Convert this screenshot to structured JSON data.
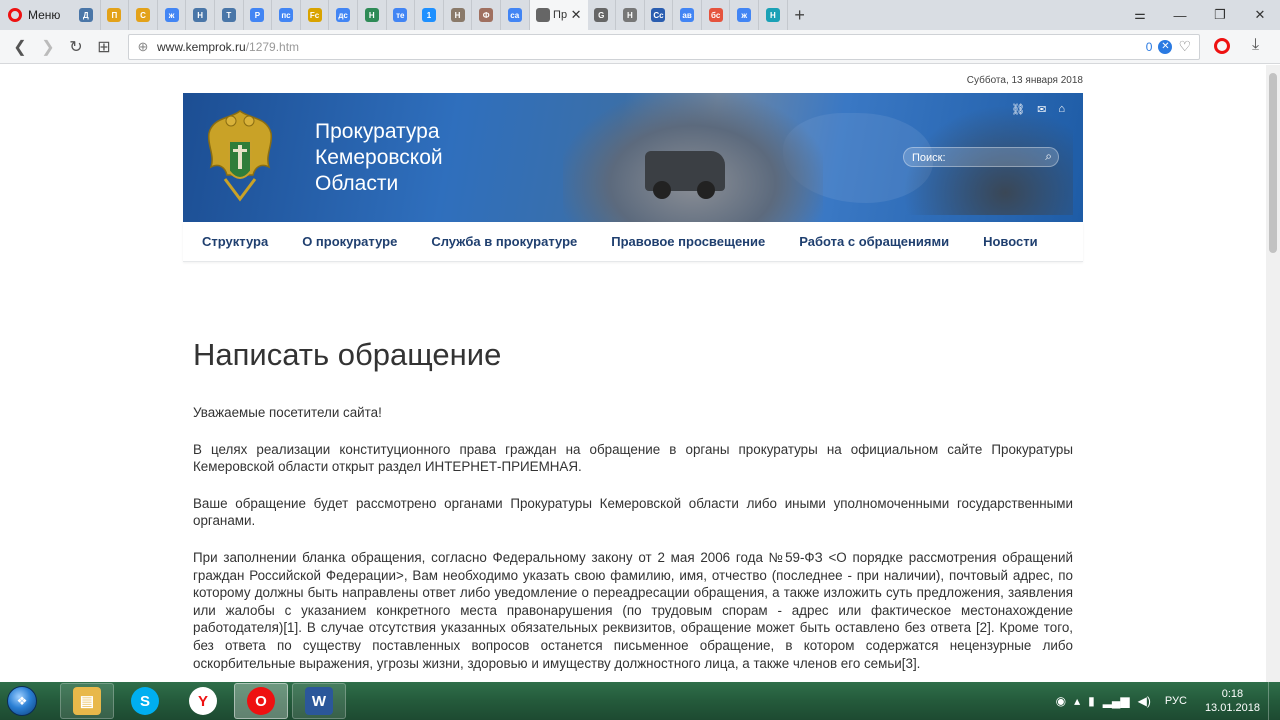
{
  "browser": {
    "menu_label": "Меню",
    "tabs": [
      {
        "label": "Д",
        "icon": "vk-doc-icon",
        "color": "#4a76a8"
      },
      {
        "label": "П",
        "icon": "site-icon",
        "color": "#e3a21a"
      },
      {
        "label": "С",
        "icon": "site-icon",
        "color": "#e3a21a"
      },
      {
        "label": "ж",
        "icon": "google-icon",
        "color": "#4285f4"
      },
      {
        "label": "Н",
        "icon": "vk-icon",
        "color": "#4a76a8"
      },
      {
        "label": "Т",
        "icon": "vk-icon",
        "color": "#4a76a8"
      },
      {
        "label": "Р",
        "icon": "google-icon",
        "color": "#4285f4"
      },
      {
        "label": "пс",
        "icon": "google-icon",
        "color": "#4285f4"
      },
      {
        "label": "Fc",
        "icon": "pencil-icon",
        "color": "#d9a300"
      },
      {
        "label": "дс",
        "icon": "google-icon",
        "color": "#4285f4"
      },
      {
        "label": "Н",
        "icon": "su-icon",
        "color": "#2e8b57"
      },
      {
        "label": "те",
        "icon": "google-icon",
        "color": "#4285f4"
      },
      {
        "label": "1",
        "icon": "chat-icon",
        "color": "#1e90ff"
      },
      {
        "label": "Н",
        "icon": "avatar-icon",
        "color": "#8a7a6a"
      },
      {
        "label": "Ф",
        "icon": "avatar-icon",
        "color": "#a07060"
      },
      {
        "label": "са",
        "icon": "google-icon",
        "color": "#4285f4"
      },
      {
        "label": "Пр",
        "icon": "page-icon",
        "color": "#666666",
        "active": true
      },
      {
        "label": "G",
        "icon": "page-icon",
        "color": "#666666"
      },
      {
        "label": "Н",
        "icon": "gear-icon",
        "color": "#777777"
      },
      {
        "label": "Сс",
        "icon": "site-icon",
        "color": "#2a5db0"
      },
      {
        "label": "ав",
        "icon": "google-icon",
        "color": "#4285f4"
      },
      {
        "label": "бс",
        "icon": "dots-icon",
        "color": "#e5533d"
      },
      {
        "label": "ж",
        "icon": "google-icon",
        "color": "#4285f4"
      },
      {
        "label": "Н",
        "icon": "shield-icon",
        "color": "#1aa1b6"
      }
    ],
    "new_tab": "+",
    "url_host": "www.kemprok.ru",
    "url_path": "/1279.htm",
    "adblock_count": "0"
  },
  "page": {
    "date": "Суббота, 13 января 2018",
    "site_title_line1": "Прокуратура",
    "site_title_line2": "Кемеровской",
    "site_title_line3": "Области",
    "search_placeholder": "Поиск:",
    "nav": [
      "Структура",
      "О прокуратуре",
      "Служба в прокуратуре",
      "Правовое просвещение",
      "Работа с обращениями",
      "Новости"
    ],
    "heading": "Написать обращение",
    "paragraphs": [
      "Уважаемые посетители сайта!",
      "В целях реализации конституционного права граждан на обращение в органы прокуратуры на официальном сайте Прокуратуры Кемеровской области открыт раздел ИНТЕРНЕТ-ПРИЕМНАЯ.",
      "Ваше обращение будет рассмотрено органами Прокуратуры Кемеровской области либо иными уполномоченными государственными органами.",
      "При заполнении бланка обращения, согласно Федеральному закону от 2 мая 2006 года №59-ФЗ <О порядке рассмотрения обращений граждан Российской Федерации>, Вам необходимо указать свою фамилию, имя, отчество (последнее - при наличии), почтовый адрес, по которому должны быть направлены ответ либо уведомление о переадресации обращения, а также изложить суть предложения, заявления или жалобы с указанием конкретного места правонарушения (по трудовым спорам - адрес или фактическое местонахождение работодателя)[1]. В случае отсутствия указанных обязательных реквизитов, обращение может быть оставлено без ответа [2]. Кроме того, без ответа по существу поставленных вопросов останется письменное обращение, в котором содержатся нецензурные либо оскорбительные выражения, угрозы жизни, здоровью и имуществу должностного лица, а также членов его семьи[3]."
    ]
  },
  "taskbar": {
    "apps": [
      {
        "name": "explorer",
        "icon": "folder-icon",
        "color": "#e8b84a",
        "glyph": "▤"
      },
      {
        "name": "skype",
        "icon": "skype-icon",
        "color": "#00aff0",
        "glyph": "S"
      },
      {
        "name": "yandex",
        "icon": "yandex-icon",
        "color": "#ffffff",
        "glyph": "Y"
      },
      {
        "name": "opera",
        "icon": "opera-icon",
        "color": "#e11",
        "glyph": "O"
      },
      {
        "name": "word",
        "icon": "word-icon",
        "color": "#2b579a",
        "glyph": "W"
      }
    ],
    "language": "РУС",
    "time": "0:18",
    "date": "13.01.2018"
  }
}
